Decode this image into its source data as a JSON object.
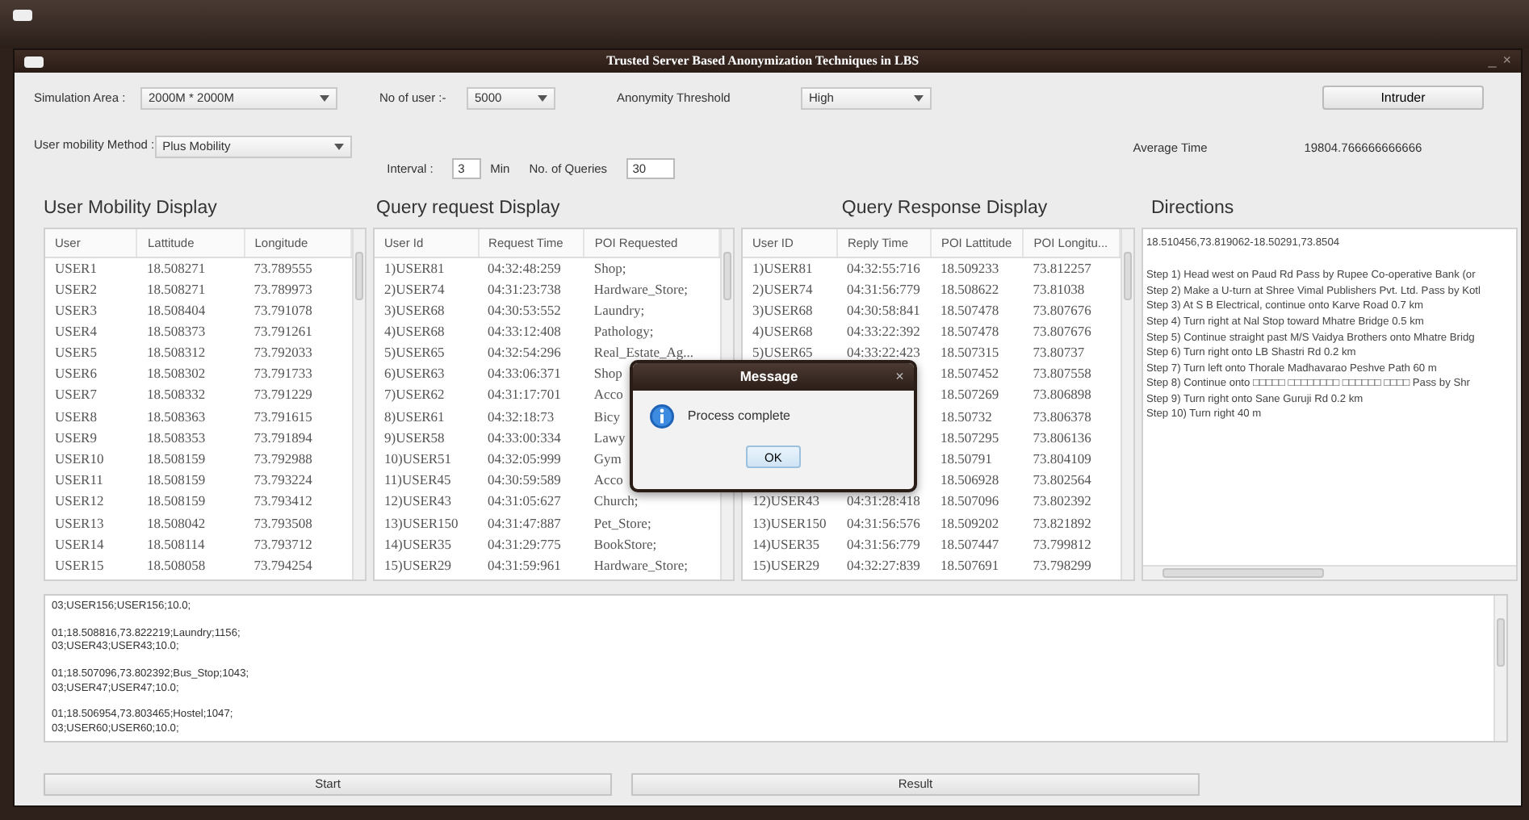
{
  "window": {
    "title": "Trusted Server Based Anonymization Techniques in LBS",
    "controls": [
      "_",
      "×"
    ]
  },
  "settings": {
    "simulation_area": {
      "label": "Simulation Area :",
      "value": "2000M * 2000M"
    },
    "no_of_user": {
      "label": "No of user :-",
      "value": "5000"
    },
    "anonymity_threshold": {
      "label": "Anonymity Threshold",
      "value": "High"
    },
    "intruder_button": "Intruder",
    "user_mobility_method": {
      "label": "User mobility Method :",
      "value": "Plus Mobility"
    },
    "interval": {
      "label": "Interval :",
      "value": "3",
      "unit": "Min"
    },
    "no_of_queries": {
      "label": "No. of Queries",
      "value": "30"
    },
    "average_time": {
      "label": "Average Time",
      "value": "19804.766666666666"
    }
  },
  "panels": [
    {
      "title": "User Mobility Display",
      "columns": [
        "User",
        "Lattitude",
        "Longitude"
      ],
      "rows": [
        [
          "USER1",
          "18.508271",
          "73.789555"
        ],
        [
          "USER2",
          "18.508271",
          "73.789973"
        ],
        [
          "USER3",
          "18.508404",
          "73.791078"
        ],
        [
          "USER4",
          "18.508373",
          "73.791261"
        ],
        [
          "USER5",
          "18.508312",
          "73.792033"
        ],
        [
          "USER6",
          "18.508302",
          "73.791733"
        ],
        [
          "USER7",
          "18.508332",
          "73.791229"
        ],
        [
          "USER8",
          "18.508363",
          "73.791615"
        ],
        [
          "USER9",
          "18.508353",
          "73.791894"
        ],
        [
          "USER10",
          "18.508159",
          "73.792988"
        ],
        [
          "USER11",
          "18.508159",
          "73.793224"
        ],
        [
          "USER12",
          "18.508159",
          "73.793412"
        ],
        [
          "USER13",
          "18.508042",
          "73.793508"
        ],
        [
          "USER14",
          "18.508114",
          "73.793712"
        ],
        [
          "USER15",
          "18.508058",
          "73.794254"
        ]
      ]
    },
    {
      "title": "Query request Display",
      "columns": [
        "User Id",
        "Request Time",
        "POI Requested"
      ],
      "rows": [
        [
          "1)USER81",
          "04:32:48:259",
          "Shop;"
        ],
        [
          "2)USER74",
          "04:31:23:738",
          "Hardware_Store;"
        ],
        [
          "3)USER68",
          "04:30:53:552",
          "Laundry;"
        ],
        [
          "4)USER68",
          "04:33:12:408",
          "Pathology;"
        ],
        [
          "5)USER65",
          "04:32:54:296",
          "Real_Estate_Ag..."
        ],
        [
          "6)USER63",
          "04:33:06:371",
          "Shop"
        ],
        [
          "7)USER62",
          "04:31:17:701",
          "Acco"
        ],
        [
          "8)USER61",
          "04:32:18:73",
          "Bicy"
        ],
        [
          "9)USER58",
          "04:33:00:334",
          "Lawy"
        ],
        [
          "10)USER51",
          "04:32:05:999",
          "Gym"
        ],
        [
          "11)USER45",
          "04:30:59:589",
          "Acco"
        ],
        [
          "12)USER43",
          "04:31:05:627",
          "Church;"
        ],
        [
          "13)USER150",
          "04:31:47:887",
          "Pet_Store;"
        ],
        [
          "14)USER35",
          "04:31:29:775",
          "BookStore;"
        ],
        [
          "15)USER29",
          "04:31:59:961",
          "Hardware_Store;"
        ]
      ]
    },
    {
      "title": "Query Response Display",
      "columns": [
        "User ID",
        "Reply Time",
        "POI Lattitude",
        "POI Longitu..."
      ],
      "rows": [
        [
          "1)USER81",
          "04:32:55:716",
          "18.509233",
          "73.812257"
        ],
        [
          "2)USER74",
          "04:31:56:779",
          "18.508622",
          "73.81038"
        ],
        [
          "3)USER68",
          "04:30:58:841",
          "18.507478",
          "73.807676"
        ],
        [
          "4)USER68",
          "04:33:22:392",
          "18.507478",
          "73.807676"
        ],
        [
          "5)USER65",
          "04:33:22:423",
          "18.507315",
          "73.80737"
        ],
        [
          null,
          null,
          "18.507452",
          "73.807558"
        ],
        [
          null,
          null,
          "18.507269",
          "73.806898"
        ],
        [
          null,
          null,
          "18.50732",
          "73.806378"
        ],
        [
          null,
          null,
          "18.507295",
          "73.806136"
        ],
        [
          null,
          null,
          "18.50791",
          "73.804109"
        ],
        [
          null,
          null,
          "18.506928",
          "73.802564"
        ],
        [
          "12)USER43",
          "04:31:28:418",
          "18.507096",
          "73.802392"
        ],
        [
          "13)USER150",
          "04:31:56:576",
          "18.509202",
          "73.821892"
        ],
        [
          "14)USER35",
          "04:31:56:779",
          "18.507447",
          "73.799812"
        ],
        [
          "15)USER29",
          "04:32:27:839",
          "18.507691",
          "73.798299"
        ]
      ]
    }
  ],
  "directions": {
    "title": "Directions",
    "route": "18.510456,73.819062-18.50291,73.8504",
    "steps": [
      "Step 1) Head  west  on  Paud Rd  Pass by Rupee Co-operative Bank (or",
      "Step 2) Make a  U-turn  at Shree Vimal Publishers Pvt. Ltd. Pass by Kotl",
      "Step 3) At S B Electrical, continue onto  Karve Road 0.7 km",
      "Step 4) Turn  right  at  Nal Stop  toward  Mhatre Bridge 0.5 km",
      "Step 5) Continue straight past M/S Vaidya Brothers onto  Mhatre Bridg",
      "Step 6) Turn  right  onto  LB Shastri Rd 0.2 km",
      "Step 7) Turn  left  onto  Thorale Madhavarao Peshve Path 60 m",
      "Step 8) Continue onto  □□□□□ □□□□□□□□ □□□□□□ □□□□  Pass by Shr",
      "Step 9) Turn  right  onto  Sane Guruji Rd 0.2 km",
      "Step 10) Turn  right 40 m"
    ]
  },
  "log": [
    [
      "03;USER156;USER156;10.0;"
    ],
    [
      "01;18.508816,73.822219;Laundry;1156;",
      "03;USER43;USER43;10.0;"
    ],
    [
      "01;18.507096,73.802392;Bus_Stop;1043;",
      "03;USER47;USER47;10.0;"
    ],
    [
      "01;18.506954,73.803465;Hostel;1047;",
      "03;USER60;USER60;10.0;"
    ]
  ],
  "buttons": [
    "Start",
    "Result"
  ],
  "dialog": {
    "title": "Message",
    "close": "×",
    "message": "Process complete",
    "button": "OK"
  }
}
